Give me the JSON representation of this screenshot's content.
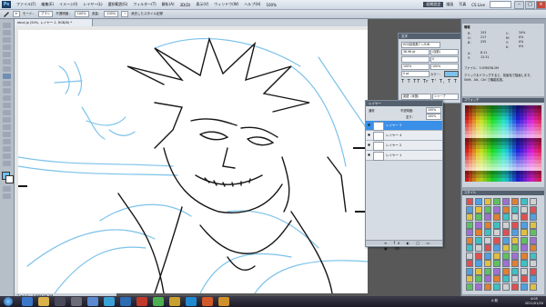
{
  "app": {
    "logo": "Ps"
  },
  "menu": {
    "items": [
      "ファイル(F)",
      "編集(E)",
      "イメージ(I)",
      "レイヤー(L)",
      "選択範囲(S)",
      "フィルター(T)",
      "解析(A)",
      "3D(D)",
      "表示(V)",
      "ウィンドウ(W)",
      "ヘルプ(H)"
    ],
    "zoom": "100%",
    "workspaces": [
      "初期設定",
      "描画",
      "写真"
    ],
    "cs_live": "CS Live"
  },
  "options": {
    "brush_label": "モード：",
    "mode": "ブラシ",
    "opacity_label": "不透明度：",
    "opacity": "100%",
    "flow_label": "流量：",
    "flow": "100%",
    "tablet_label": "消去したスタイル記録"
  },
  "document": {
    "tab_label": "ebcd.jp (50%, レイヤー 2, RGB/8) *",
    "status": "ファイル：3.93M/36.2M"
  },
  "character_panel": {
    "title": "文字",
    "font": "HGS創英角ｺﾞｼｯｸUB",
    "size": "36.96 pt",
    "leading": "(自動)",
    "tracking": "0",
    "scale_v": "100%",
    "scale_h": "100%",
    "baseline": "0 pt",
    "color_label": "カラー：",
    "language": "英語（米国）",
    "aa": "シャープ"
  },
  "layers_panel": {
    "title": "レイヤー",
    "blend": "通常",
    "opacity_label": "不透明度：",
    "opacity": "100%",
    "fill_label": "塗り：",
    "fill": "100%",
    "layers": [
      {
        "name": "レイヤー 3",
        "selected": true
      },
      {
        "name": "レイヤー 4",
        "selected": false
      },
      {
        "name": "レイヤー 2",
        "selected": false
      },
      {
        "name": "レイヤー 1",
        "selected": false
      }
    ]
  },
  "info_panel": {
    "title": "情報",
    "r": "R：",
    "g": "G：",
    "b": "B：",
    "rv": "153",
    "gv": "217",
    "bv": "255",
    "c": "C：",
    "m": "M：",
    "y": "Y：",
    "k": "K：",
    "cv": "34%",
    "mv": "0%",
    "yv": "0%",
    "kv": "0%",
    "x": "X：",
    "y2": "Y：",
    "xv": "8.11",
    "yv2": "13.31",
    "doc": "ファイル：3.93M/36.2M",
    "hint": "クリック＆ドラッグすると、前景色で描画します。Shift、Alt、Ctrl で機能拡張。"
  },
  "swatches_panel": {
    "title": "スウォッチ"
  },
  "styles_panel": {
    "title": "スタイル"
  },
  "clock": {
    "time": "4:05",
    "date": "2011/01/20",
    "lang": "A 般"
  },
  "colors": {
    "accent": "#3a8fe8",
    "sketch_blue": "#7cc2ea",
    "sketch_line": "#161616",
    "taskbar": "#252432"
  }
}
